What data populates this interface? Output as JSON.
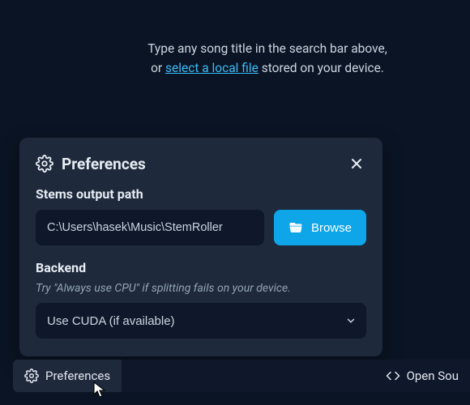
{
  "hint": {
    "line1": "Type any song title in the search bar above,",
    "line2a": "or ",
    "link": "select a local file",
    "line2b": " stored on your device."
  },
  "panel": {
    "title": "Preferences",
    "stems_label": "Stems output path",
    "stems_value": "C:\\Users\\hasek\\Music\\StemRoller",
    "browse_label": "Browse",
    "backend_label": "Backend",
    "backend_hint": "Try \"Always use CPU\" if splitting fails on your device.",
    "backend_value": "Use CUDA (if available)"
  },
  "bottombar": {
    "preferences": "Preferences",
    "opensource": "Open Sou"
  },
  "colors": {
    "accent": "#0ea5e9",
    "panel": "#1e293b",
    "bg": "#0b1424",
    "input": "#0f172a"
  }
}
